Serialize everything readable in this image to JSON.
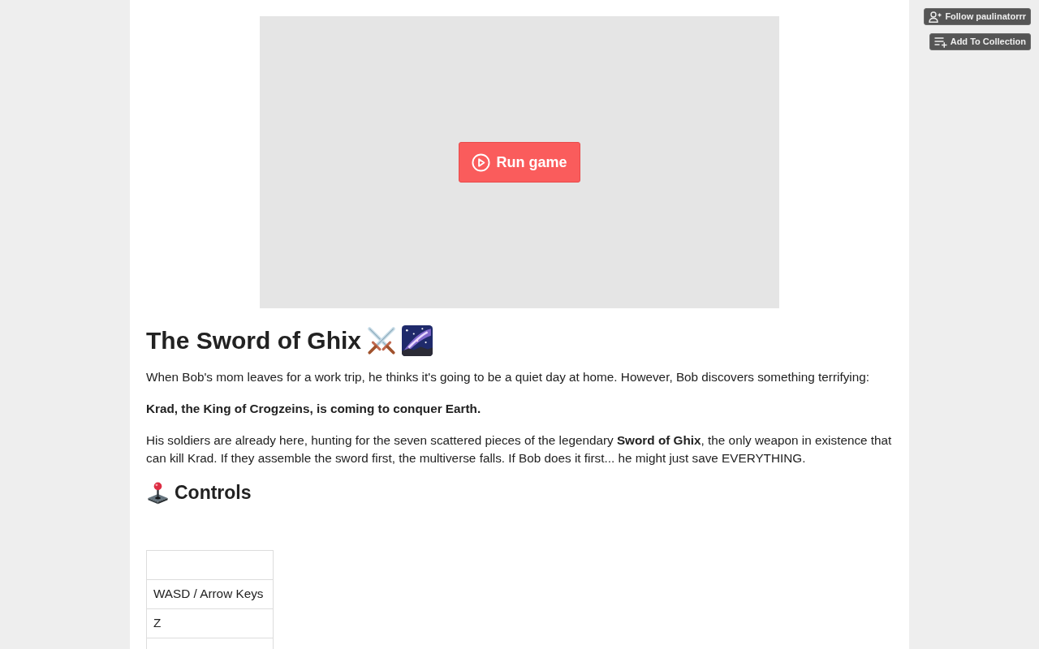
{
  "top_actions": [
    {
      "kind": "follow",
      "label": "Follow paulinatorrr"
    },
    {
      "kind": "collection",
      "label": "Add To Collection"
    }
  ],
  "game": {
    "run_button": "Run game"
  },
  "title": "The Sword of Ghix",
  "description": [
    {
      "kind": "plain",
      "text": "When Bob's mom leaves for a work trip, he thinks it's going to be a quiet day at home. However, Bob discovers something terrifying:"
    },
    {
      "kind": "bold",
      "text": "Krad, the King of Crogzeins, is coming to conquer Earth."
    },
    {
      "kind": "plain",
      "text": "His soldiers are already here, hunting for the seven scattered pieces of the legendary **Sword of Ghix**, the only weapon in existence that can kill Krad. If they assemble the sword first, the multiverse falls. If Bob does it first... he might just save EVERYTHING."
    }
  ],
  "controls": {
    "heading": "Controls",
    "rows": [
      {
        "cells": [
          "WASD / Arrow Keys"
        ]
      },
      {
        "cells": [
          "Z"
        ]
      }
    ]
  }
}
